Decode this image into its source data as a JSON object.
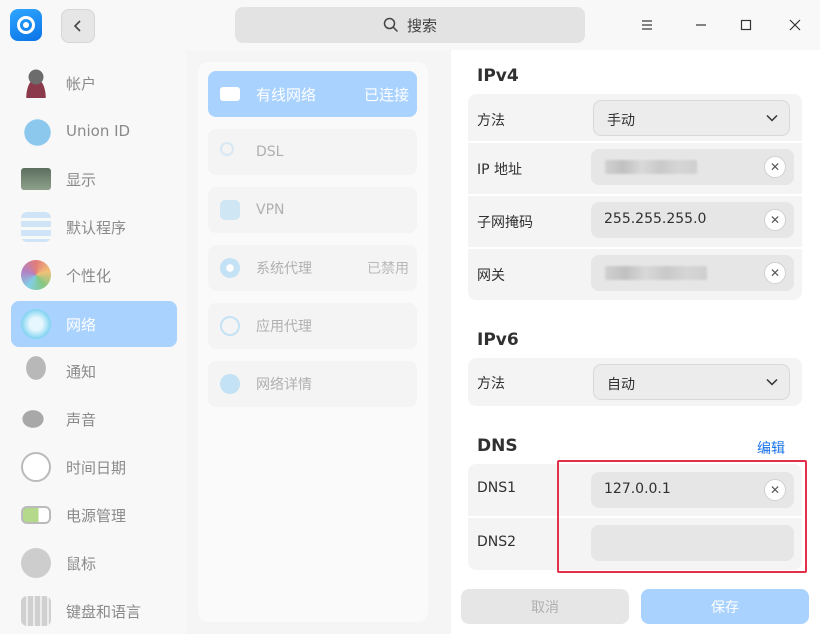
{
  "titlebar": {
    "search_placeholder": "搜索"
  },
  "sidebar": {
    "items": [
      {
        "label": "帐户",
        "icon": "user-icon"
      },
      {
        "label": "Union ID",
        "icon": "cloud-icon"
      },
      {
        "label": "显示",
        "icon": "monitor-icon"
      },
      {
        "label": "默认程序",
        "icon": "default-apps-icon"
      },
      {
        "label": "个性化",
        "icon": "palette-icon"
      },
      {
        "label": "网络",
        "icon": "network-icon",
        "active": true
      },
      {
        "label": "通知",
        "icon": "bell-icon"
      },
      {
        "label": "声音",
        "icon": "speaker-icon"
      },
      {
        "label": "时间日期",
        "icon": "clock-icon"
      },
      {
        "label": "电源管理",
        "icon": "battery-icon"
      },
      {
        "label": "鼠标",
        "icon": "mouse-icon"
      },
      {
        "label": "键盘和语言",
        "icon": "keyboard-icon"
      }
    ]
  },
  "network_menu": {
    "items": [
      {
        "label": "有线网络",
        "status": "已连接",
        "icon": "wired-icon",
        "active": true
      },
      {
        "label": "DSL",
        "status": "",
        "icon": "dsl-icon"
      },
      {
        "label": "VPN",
        "status": "",
        "icon": "vpn-icon"
      },
      {
        "label": "系统代理",
        "status": "已禁用",
        "icon": "system-proxy-icon"
      },
      {
        "label": "应用代理",
        "status": "",
        "icon": "app-proxy-icon"
      },
      {
        "label": "网络详情",
        "status": "",
        "icon": "info-icon"
      }
    ]
  },
  "ipv4": {
    "title": "IPv4",
    "method_label": "方法",
    "method_value": "手动",
    "ip_label": "IP 地址",
    "mask_label": "子网掩码",
    "mask_value": "255.255.255.0",
    "gateway_label": "网关"
  },
  "ipv6": {
    "title": "IPv6",
    "method_label": "方法",
    "method_value": "自动"
  },
  "dns": {
    "title": "DNS",
    "edit_label": "编辑",
    "dns1_label": "DNS1",
    "dns1_value": "127.0.0.1",
    "dns2_label": "DNS2",
    "dns2_value": ""
  },
  "footer": {
    "cancel_label": "取消",
    "save_label": "保存"
  },
  "colors": {
    "accent": "#a9d2ff",
    "link": "#1a73e8",
    "highlight": "#e0304a"
  }
}
